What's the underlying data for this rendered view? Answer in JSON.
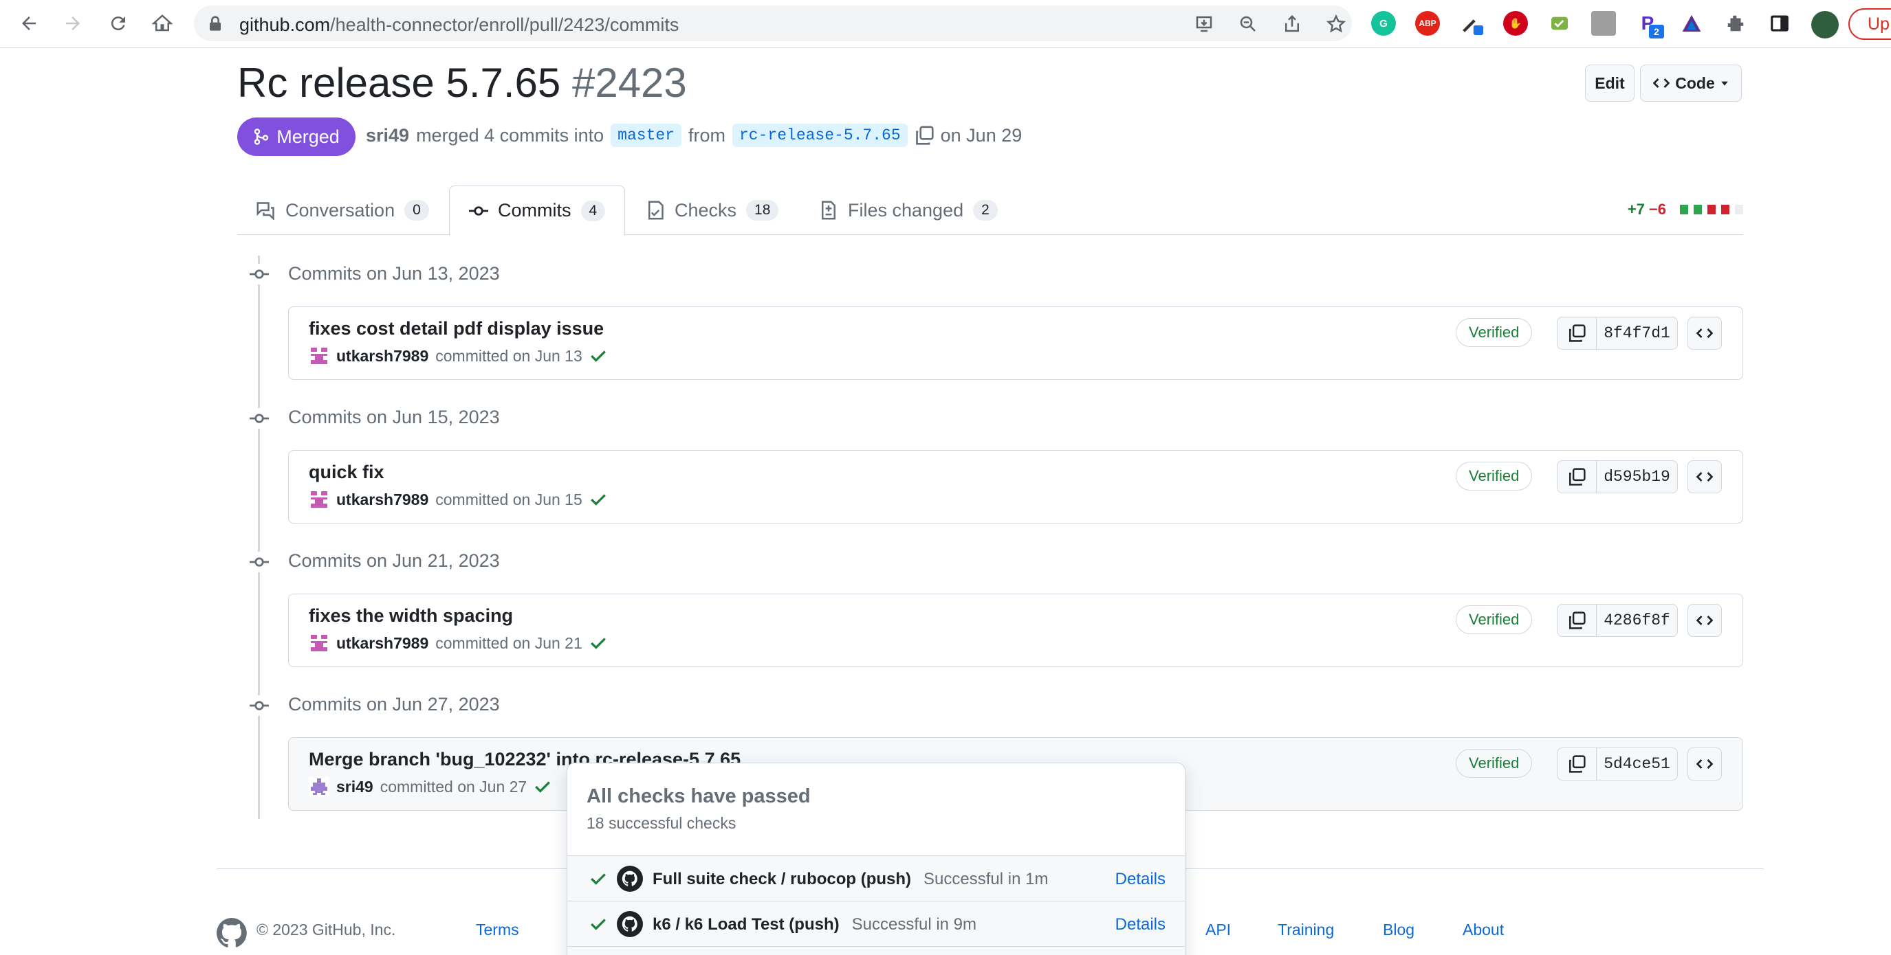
{
  "browser": {
    "url_host": "github.com",
    "url_path": "/health-connector/enroll/pull/2423/commits",
    "update_label": "Up",
    "extensions": [
      "grammarly-icon",
      "adblock-plus-icon",
      "color-picker-icon",
      "ublock-icon",
      "inbox-icon",
      "profile-image-icon",
      "extension-p-icon",
      "extension-triangle-icon",
      "puzzle-icon",
      "sidebar-icon",
      "user-avatar-icon"
    ],
    "ext_badge": "2"
  },
  "pr": {
    "title": "Rc release 5.7.65",
    "number": "#2423",
    "edit_label": "Edit",
    "code_label": "Code",
    "status": "Merged",
    "author": "sri49",
    "merged_text": "merged 4 commits into",
    "base_branch": "master",
    "from_text": "from",
    "head_branch": "rc-release-5.7.65",
    "date_text": "on Jun 29"
  },
  "tabs": [
    {
      "label": "Conversation",
      "count": "0"
    },
    {
      "label": "Commits",
      "count": "4"
    },
    {
      "label": "Checks",
      "count": "18"
    },
    {
      "label": "Files changed",
      "count": "2"
    }
  ],
  "diffstat": {
    "additions": "+7",
    "deletions": "−6"
  },
  "commit_groups": [
    {
      "date": "Commits on Jun 13, 2023",
      "title": "fixes cost detail pdf display issue",
      "author": "utkarsh7989",
      "when": "committed on Jun 13",
      "verified": "Verified",
      "sha": "8f4f7d1"
    },
    {
      "date": "Commits on Jun 15, 2023",
      "title": "quick fix",
      "author": "utkarsh7989",
      "when": "committed on Jun 15",
      "verified": "Verified",
      "sha": "d595b19"
    },
    {
      "date": "Commits on Jun 21, 2023",
      "title": "fixes the width spacing",
      "author": "utkarsh7989",
      "when": "committed on Jun 21",
      "verified": "Verified",
      "sha": "4286f8f"
    },
    {
      "date": "Commits on Jun 27, 2023",
      "title": "Merge branch 'bug_102232' into rc-release-5.7.65",
      "author": "sri49",
      "when": "committed on Jun 27",
      "verified": "Verified",
      "sha": "5d4ce51"
    }
  ],
  "checks_popover": {
    "title": "All checks have passed",
    "subtitle": "18 successful checks",
    "checks": [
      {
        "name": "Full suite check / rubocop (push)",
        "status": "Successful in 1m",
        "details": "Details"
      },
      {
        "name": "k6 / k6 Load Test (push)",
        "status": "Successful in 9m",
        "details": "Details"
      }
    ]
  },
  "footer": {
    "copyright": "© 2023 GitHub, Inc.",
    "links": [
      "Terms",
      "API",
      "Training",
      "Blog",
      "About"
    ]
  },
  "colors": {
    "merged": "#8250df",
    "success": "#1a7f37",
    "danger": "#cf222e",
    "link": "#0969da"
  }
}
